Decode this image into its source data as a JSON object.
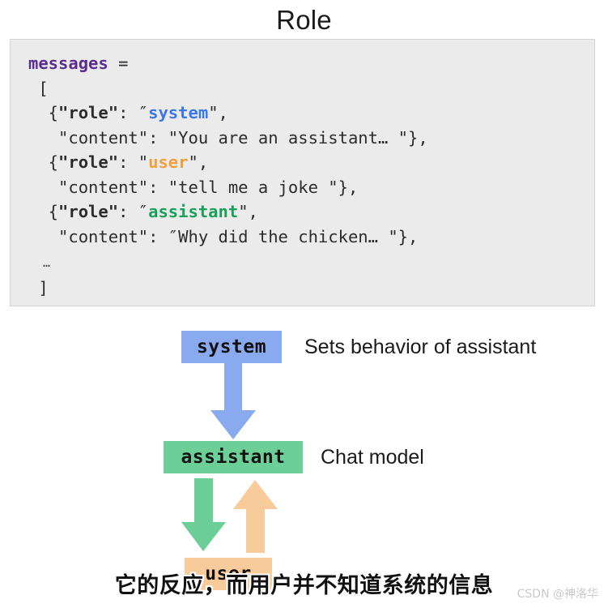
{
  "page": {
    "title": "Role"
  },
  "code_block": {
    "lines": [
      [
        {
          "t": "messages ",
          "c": "var"
        },
        {
          "t": "=",
          "c": "plain"
        }
      ],
      [
        {
          "t": " [",
          "c": "plain"
        }
      ],
      [
        {
          "t": "  {",
          "c": "plain"
        },
        {
          "t": "\"role\"",
          "c": "key"
        },
        {
          "t": ": ″",
          "c": "plain"
        },
        {
          "t": "system",
          "c": "system"
        },
        {
          "t": "\",",
          "c": "plain"
        }
      ],
      [
        {
          "t": "   \"content\": \"You are an assistant… \"},",
          "c": "plain"
        }
      ],
      [
        {
          "t": "  {",
          "c": "plain"
        },
        {
          "t": "\"role\"",
          "c": "key"
        },
        {
          "t": ": \"",
          "c": "plain"
        },
        {
          "t": "user",
          "c": "user"
        },
        {
          "t": "\",",
          "c": "plain"
        }
      ],
      [
        {
          "t": "   \"content\": \"tell me a joke \"},",
          "c": "plain"
        }
      ],
      [
        {
          "t": "  {",
          "c": "plain"
        },
        {
          "t": "\"role\"",
          "c": "key"
        },
        {
          "t": ": ″",
          "c": "plain"
        },
        {
          "t": "assistant",
          "c": "assist"
        },
        {
          "t": "\",",
          "c": "plain"
        }
      ],
      [
        {
          "t": "   \"content\": ″Why did the chicken… \"},",
          "c": "plain"
        }
      ],
      [
        {
          "t": "  …",
          "c": "dots"
        }
      ],
      [
        {
          "t": " ]",
          "c": "plain"
        }
      ]
    ]
  },
  "diagram": {
    "boxes": {
      "system": {
        "label": "system",
        "color": "#8aaaf0"
      },
      "assistant": {
        "label": "assistant",
        "color": "#6dcf98"
      },
      "user": {
        "label": "user",
        "color": "#f8cb9a"
      }
    },
    "labels": {
      "system_desc": "Sets behavior of assistant",
      "assistant_desc": "Chat model"
    },
    "arrows": {
      "system_to_assistant": {
        "name": "down-arrow-blue",
        "color": "#8aaaf0",
        "direction": "down"
      },
      "assistant_to_user": {
        "name": "down-arrow-green",
        "color": "#6dcf98",
        "direction": "down"
      },
      "user_to_assistant": {
        "name": "up-arrow-orange",
        "color": "#f8cb9a",
        "direction": "up"
      }
    }
  },
  "subtitle": {
    "text": "它的反应，而用户并不知道系统的信息"
  },
  "watermark": {
    "text": "CSDN @神洛华"
  }
}
